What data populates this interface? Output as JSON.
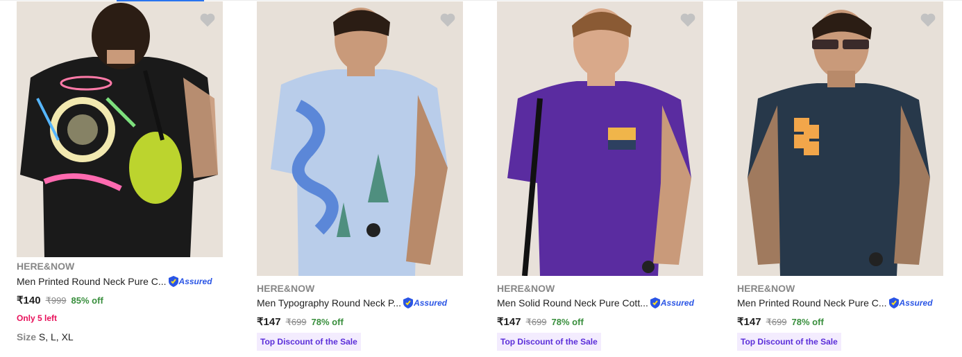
{
  "products": [
    {
      "brand": "HERE&NOW",
      "title": "Men Printed Round Neck Pure C...",
      "assured_label": "Assured",
      "price": "₹140",
      "mrp": "₹999",
      "discount": "85% off",
      "stock_note": "Only 5 left",
      "size_label": "Size",
      "sizes": "S, L, XL",
      "tshirt_color": "#1a1a1a",
      "background_color": "#e8e1d9"
    },
    {
      "brand": "HERE&NOW",
      "title": "Men Typography Round Neck P...",
      "assured_label": "Assured",
      "price": "₹147",
      "mrp": "₹699",
      "discount": "78% off",
      "offer_tag": "Top Discount of the Sale",
      "tshirt_color": "#b9cdea",
      "background_color": "#e7e0d8"
    },
    {
      "brand": "HERE&NOW",
      "title": "Men Solid Round Neck Pure Cott...",
      "assured_label": "Assured",
      "price": "₹147",
      "mrp": "₹699",
      "discount": "78% off",
      "offer_tag": "Top Discount of the Sale",
      "tshirt_color": "#5a2ca0",
      "background_color": "#e8e1da"
    },
    {
      "brand": "HERE&NOW",
      "title": "Men Printed Round Neck Pure C...",
      "assured_label": "Assured",
      "price": "₹147",
      "mrp": "₹699",
      "discount": "78% off",
      "offer_tag": "Top Discount of the Sale",
      "tshirt_color": "#27384a",
      "background_color": "#e7e0d8"
    }
  ],
  "colors": {
    "accent": "#2874f0",
    "discount_green": "#388e3c",
    "stock_pink": "#e8105a",
    "offer_purple": "#5a2dd9",
    "offer_bg": "#f3ecfe",
    "muted_text": "#878787"
  }
}
